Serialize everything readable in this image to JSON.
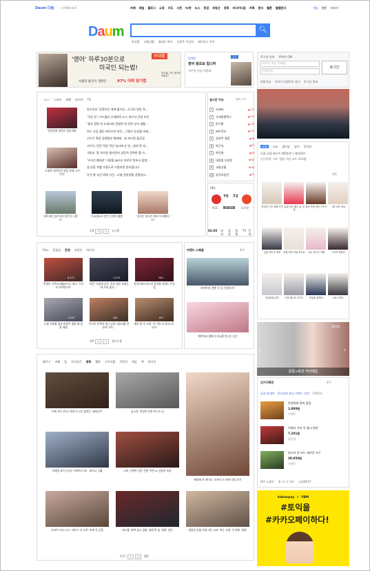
{
  "topbar": {
    "logo": "Daum 다음",
    "set_home": "시작페이지로",
    "nav": [
      "카페",
      "메일",
      "블로그",
      "쇼핑",
      "지도",
      "사전",
      "tv팟",
      "뉴스",
      "증권",
      "부동산",
      "영화",
      "미디어다음",
      "카톡",
      "문서",
      "웹툰",
      "웹캘린더"
    ],
    "right": [
      "게임",
      "웹툰",
      "더보기"
    ]
  },
  "logo": {
    "d": "D",
    "a": "a",
    "u": "u",
    "m": "m"
  },
  "keywords": [
    "박성웅",
    "교통상황",
    "볼레디 북키",
    "공현주 이상연",
    "레이처스 주미"
  ],
  "banner_ad": {
    "quote": "'영어' 하루30분으로",
    "line2": "미국인 되는법!",
    "badge": "보내줄",
    "foot": "서울대 출신이 개발한",
    "pct": "97% 어휘 암기법",
    "side": "라이블 스타 영어의 비밀은?",
    "side2": "강제 실제 명이"
  },
  "promo": {
    "title": "영어 왕초보 입니까",
    "sub": "식은일 러닝 지원돼",
    "small": "믿에인",
    "pg": "1/3"
  },
  "login": {
    "keep": "로그인 유지",
    "ip": "IP보안 ON",
    "id_ph": "아이디 또는 이메일",
    "pw_ph": "비밀번호",
    "btn": "로그인",
    "links": [
      "회원가입",
      "아이디 비밀번호 찾기",
      "로그인 정보"
    ]
  },
  "news": {
    "tabs": [
      "뉴스",
      "스포츠",
      "연예",
      "라이프",
      "TV"
    ],
    "items": [
      {
        "cap": "'인천공항 발묶인 탑승객들'"
      },
      {
        "cap": "'도쿄한 내린라인 현장 포에, 0이가이'"
      }
    ],
    "headlines": [
      "동지국부 '김정은은 세계 불가능...도국이 방동 화...",
      "'국유 찬 / 가드롤사 무궤대적 뉴스 테스더 건설 추진",
      "'결국 정말 대 도세크와 전달한 대 진한 상사 생활...",
      "카드 산업 올린 태국으로 판단...그릴이 유성을 미래...",
      "선거구 획정 경쟁점만 했세레...일 지나면 불공정",
      "사우디, 탄탄 직증 적인 실시에 순 반...분야 된 되...",
      "국방부 '北 미사일 발사준비 상당히 진척한 틀 가...",
      "'우리선 예대로' 이정할 늘리고 피로로 변초사 합병...",
      "설 연휴 허를 우흥도로 이용하면 판리합니다",
      "우선 팔 서선 밖에 사건...오늘 현장점통 경협실시..."
    ],
    "cards": [
      {
        "cap": "비트코인 일주식이 탑주가 나왔다",
        "badge": "스포츠건강"
      },
      {
        "cap": "'거시정도로 만든 단편의 활용'"
      },
      {
        "cap": "'자기는 있다가 파리 다 배웠다니?'"
      }
    ],
    "pg": "1/6",
    "more": "뉴스홈"
  },
  "trending": {
    "title": "실시간 이슈",
    "tab": "검색 2.4T",
    "rows": [
      {
        "n": "1",
        "t": "씨세씨",
        "v": "▲210"
      },
      {
        "n": "2",
        "t": "국세청홈택스",
        "v": "▲145"
      },
      {
        "n": "3",
        "t": "한기환",
        "v": "▲130"
      },
      {
        "n": "4",
        "t": "배우학교",
        "v": "▲115"
      },
      {
        "n": "5",
        "t": "공현주 결혼",
        "v": "▲98"
      },
      {
        "n": "6",
        "t": "박근속",
        "v": "▲81"
      },
      {
        "n": "7",
        "t": "박선영",
        "v": "▲60"
      },
      {
        "n": "8",
        "t": "대정원 부정한",
        "v": "NEW"
      },
      {
        "n": "9",
        "t": "교통상황",
        "v": "NEW"
      },
      {
        "n": "10",
        "t": "동작부등민",
        "v": "▲22"
      }
    ]
  },
  "kbl": {
    "label": "KBL",
    "home": "KGC",
    "away": "오리온",
    "score_home": "75",
    "score_away": "72",
    "status": "경기종료",
    "date": "02.05",
    "tabs": [
      "날씨",
      "증권",
      "환율",
      "TV",
      "운세"
    ]
  },
  "mid": {
    "tabs": [
      "Plus",
      "동영상",
      "운영",
      "부동산",
      "머즈샷"
    ],
    "cards": [
      {
        "cap": "전쟁이 '인력소래돌리드도 계고, 이건 저 여러편으로'",
        "v": "8,471"
      },
      {
        "cap": "'카탄' 조정래 감독 '친자 힘은 되었는데 사과 출국...'",
        "v": "1,470"
      },
      {
        "cap": "한국의네드러드리 동색합 과정도 운영업",
        "v": "264"
      },
      {
        "cap": "노벨 사회를 결과 피정이 결합 웹 팀 잘 재필",
        "v": "1,450"
      },
      {
        "cap": "우리부 유적에 개나 상정 사업자를 전부에 구라...",
        "v": "284"
      },
      {
        "cap": "예전 말 차 조회, 하 이영 씨 말하고도 '라고'",
        "v": "100"
      }
    ],
    "pg": "4/6",
    "more": "플러스홈"
  },
  "brand": {
    "title": "브랜드 스페셜",
    "pg": "4/4",
    "cap1": "자마이에, 편한 단 숨 인증하기?",
    "cap2": "화면에서 팔찌가 비뉴를 만나는 순간"
  },
  "shop": {
    "tabs": [
      "쇼핑",
      "쇼호",
      "원더뷰",
      "뷰티",
      "루티뷰"
    ],
    "sub": "다음 쇼핑 베스트 MD추천 | 레저정보",
    "cats": "인기검색: 지도 명품 가방 코트 SSG몰",
    "pg": "1/6",
    "items": [
      {
        "cap": "미얀마 기인 새해 가격"
      },
      {
        "cap": "실빛 온도 빨간 입 여밀"
      },
      {
        "cap": "뷰티 판매 대신 가이드"
      },
      {
        "cap": "기본 셔츠 재킷"
      },
      {
        "cap": "신발 마리 보 세트"
      },
      {
        "cap": "명품 백과 리뷰 포인트"
      },
      {
        "cap": "니트 카디건 크롭"
      },
      {
        "cap": "스카프 컬렉션"
      },
      {
        "cap": "까르띠에 워치"
      },
      {
        "cap": "다운 베스트 가이드"
      },
      {
        "cap": "운동화 컬렉션"
      },
      {
        "cap": "니트 드레스"
      }
    ]
  },
  "banner2": {
    "title": "중절+화관 커버메일",
    "pg": "16/16"
  },
  "hot_deal": {
    "title": "인기기획전",
    "pg": "4/7",
    "tabs": [
      "글자 판세프",
      "인디자파 최신 브랜드 추천",
      "기획전도"
    ],
    "items": [
      {
        "t": "한정판매 밀착 꽃집",
        "p": "1,800원",
        "s": "이벤트"
      },
      {
        "t": "어제가 가지 막 출시 원한",
        "p": "7,201원",
        "s": "할인중"
      },
      {
        "t": "밀크카 폰 보드 새로운 쏘수",
        "p": "29,950원",
        "s": "이벤트"
      }
    ],
    "foot": [
      "DIY 쇼핑하",
      "할 사 라 리프",
      "쇼핑BEST"
    ]
  },
  "ad_right": {
    "brand1": "kakaopay",
    "x": "×",
    "brand2": "YBM",
    "l1": "#토익을",
    "l2": "#카카오페이하다!"
  },
  "culture": {
    "tabs": [
      "블로그",
      "카페",
      "팁",
      "지식공간",
      "영화",
      "웹툰",
      "스토리볼",
      "브런치",
      "게임",
      "책",
      "미디어"
    ],
    "items": [
      {
        "cap": "이제 가도 부다? 현지가 너무 방하는 '레버넌트'"
      },
      {
        "cap": "김소연, 폭굉의 안면 보너스 당"
      },
      {
        "cap": ""
      },
      {
        "cap": "브레얼 코이 가시는 브레이크 배 – 떠다니 나를"
      },
      {
        "cap": "시야, 이벤트 정돈 전한 이번 ss 선방의 비상"
      },
      {
        "cap": "제대에 자 레이크, 호프리 오 비에 내일 보기"
      },
      {
        "cap": "커리어 다리 나기, '레이스 카 다로' 하게 투 굳함"
      },
      {
        "cap": "'데드풀' 완벽 칩고 공할 '새해 혹 없 '영화' 판단'"
      },
      {
        "cap": "영원한 달빛 아래 가도 교포 '혀는 사람' 이 영화 '계양'"
      }
    ],
    "pg": "5/11",
    "more": "웹툰"
  },
  "colors": {
    "accent": "#3b84f3",
    "red": "#e03030",
    "yellow": "#ffe600"
  }
}
